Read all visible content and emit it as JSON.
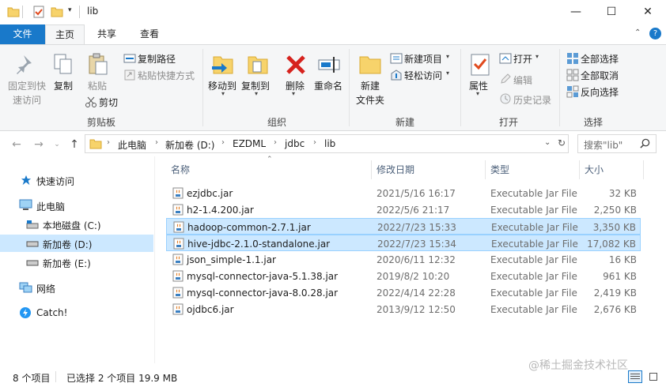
{
  "window": {
    "title": "lib",
    "controls": [
      "minimize-icon",
      "maximize-icon",
      "close-icon"
    ]
  },
  "ribbon": {
    "tabs": [
      "文件",
      "主页",
      "共享",
      "查看"
    ],
    "active_tab": "主页",
    "groups": {
      "clipboard": {
        "label": "剪贴板",
        "pin_quick_access_line1": "固定到快",
        "pin_quick_access_line2": "速访问",
        "copy": "复制",
        "paste": "粘贴",
        "copy_path": "复制路径",
        "paste_shortcut": "粘贴快捷方式",
        "cut": "剪切"
      },
      "organize": {
        "label": "组织",
        "move_to": "移动到",
        "copy_to": "复制到",
        "delete": "删除",
        "rename": "重命名"
      },
      "new": {
        "label": "新建",
        "new_folder_line1": "新建",
        "new_folder_line2": "文件夹",
        "new_item": "新建项目",
        "easy_access": "轻松访问"
      },
      "open": {
        "label": "打开",
        "properties": "属性",
        "open": "打开",
        "edit": "编辑",
        "history": "历史记录"
      },
      "select": {
        "label": "选择",
        "select_all": "全部选择",
        "select_none": "全部取消",
        "invert": "反向选择"
      }
    }
  },
  "address": {
    "breadcrumbs": [
      "此电脑",
      "新加卷 (D:)",
      "EZDML",
      "jdbc",
      "lib"
    ],
    "search_placeholder": "搜索\"lib\""
  },
  "nav_pane": {
    "items": [
      {
        "label": "快速访问",
        "icon": "star-icon"
      },
      {
        "label": "此电脑",
        "icon": "computer-icon"
      },
      {
        "label": "本地磁盘 (C:)",
        "icon": "drive-icon"
      },
      {
        "label": "新加卷 (D:)",
        "icon": "drive-icon",
        "selected": true
      },
      {
        "label": "新加卷 (E:)",
        "icon": "drive-icon"
      },
      {
        "label": "网络",
        "icon": "network-icon"
      },
      {
        "label": "Catch!",
        "icon": "catch-icon"
      }
    ]
  },
  "file_list": {
    "columns": [
      "名称",
      "修改日期",
      "类型",
      "大小"
    ],
    "rows": [
      {
        "name": "ezjdbc.jar",
        "date": "2021/5/16 16:17",
        "type": "Executable Jar File",
        "size": "32 KB",
        "selected": false
      },
      {
        "name": "h2-1.4.200.jar",
        "date": "2022/5/6 21:17",
        "type": "Executable Jar File",
        "size": "2,250 KB",
        "selected": false
      },
      {
        "name": "hadoop-common-2.7.1.jar",
        "date": "2022/7/23 15:33",
        "type": "Executable Jar File",
        "size": "3,350 KB",
        "selected": true
      },
      {
        "name": "hive-jdbc-2.1.0-standalone.jar",
        "date": "2022/7/23 15:34",
        "type": "Executable Jar File",
        "size": "17,082 KB",
        "selected": true
      },
      {
        "name": "json_simple-1.1.jar",
        "date": "2020/6/11 12:32",
        "type": "Executable Jar File",
        "size": "16 KB",
        "selected": false
      },
      {
        "name": "mysql-connector-java-5.1.38.jar",
        "date": "2019/8/2 10:20",
        "type": "Executable Jar File",
        "size": "961 KB",
        "selected": false
      },
      {
        "name": "mysql-connector-java-8.0.28.jar",
        "date": "2022/4/14 22:28",
        "type": "Executable Jar File",
        "size": "2,419 KB",
        "selected": false
      },
      {
        "name": "ojdbc6.jar",
        "date": "2013/9/12 12:50",
        "type": "Executable Jar File",
        "size": "2,676 KB",
        "selected": false
      }
    ]
  },
  "status_bar": {
    "item_count": "8 个项目",
    "selection": "已选择 2 个项目 19.9 MB"
  },
  "watermark": "@稀土掘金技术社区",
  "colors": {
    "accent": "#1979ca",
    "selection": "#cce8ff",
    "selection_border": "#99d1ff"
  }
}
